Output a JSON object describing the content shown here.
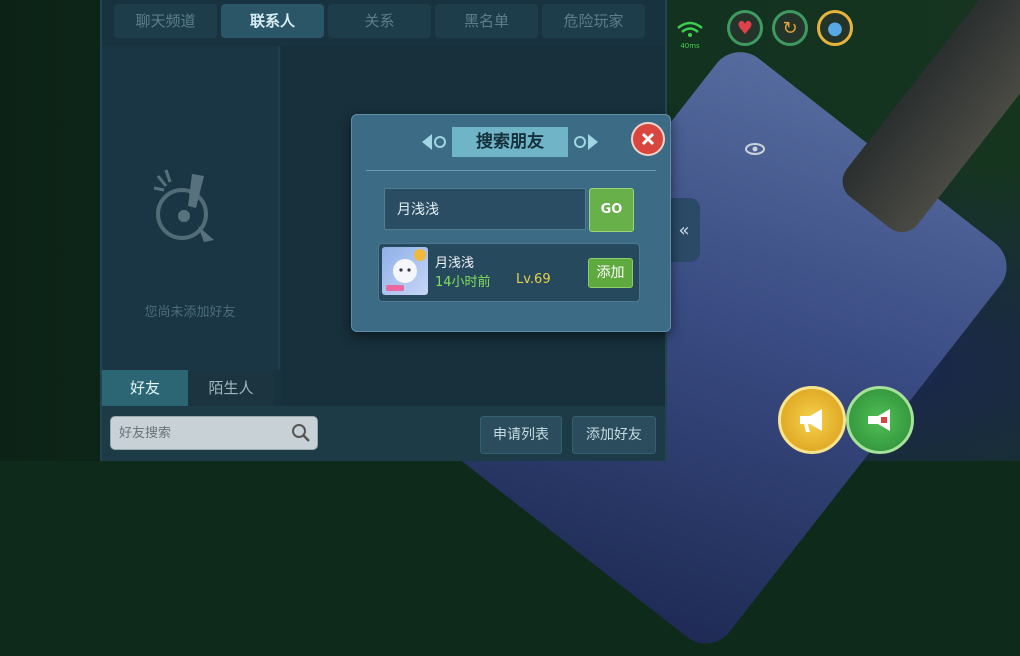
{
  "tabs": [
    {
      "label": "聊天频道",
      "active": false
    },
    {
      "label": "联系人",
      "active": true
    },
    {
      "label": "关系",
      "active": false
    },
    {
      "label": "黑名单",
      "active": false
    },
    {
      "label": "危险玩家",
      "active": false
    }
  ],
  "empty_state": {
    "text": "您尚未添加好友",
    "icon": "exclamation-speech-icon"
  },
  "sub_tabs": [
    {
      "label": "好友",
      "active": true
    },
    {
      "label": "陌生人",
      "active": false
    }
  ],
  "bottom": {
    "search_placeholder": "好友搜索",
    "apply_list_label": "申请列表",
    "add_friend_label": "添加好友"
  },
  "hud": {
    "signal_text": "40ms",
    "heart_icon": "heart-icon",
    "stamina_icon": "stamina-icon",
    "water_icon": "water-drop-icon"
  },
  "modal": {
    "title": "搜索朋友",
    "query_value": "月浅浅",
    "go_label": "GO",
    "result": {
      "name": "月浅浅",
      "last_online": "14小时前",
      "level": "Lv.69",
      "add_label": "添加"
    }
  },
  "colors": {
    "accent_green": "#67b04a",
    "close_red": "#d9453f",
    "level_yellow": "#e8d149"
  }
}
